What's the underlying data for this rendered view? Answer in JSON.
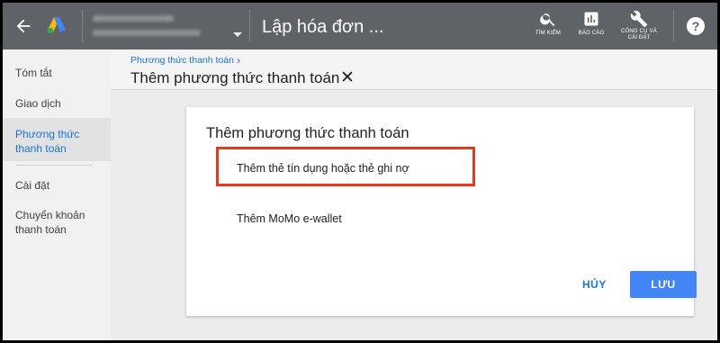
{
  "header": {
    "title": "Lập hóa đơn ...",
    "tools": [
      {
        "icon": "search-icon",
        "label": "TÌM KIẾM"
      },
      {
        "icon": "bar-chart-icon",
        "label": "BÁO CÁO"
      },
      {
        "icon": "wrench-icon",
        "label_line1": "CÔNG CỤ VÀ",
        "label_line2": "CÀI ĐẶT"
      }
    ],
    "help": "?"
  },
  "sidebar": {
    "items": [
      {
        "label": "Tóm tắt"
      },
      {
        "label": "Giao dịch"
      },
      {
        "label_line1": "Phương thức",
        "label_line2": "thanh toán",
        "active": true
      },
      {
        "label": "Cài đặt"
      },
      {
        "label_line1": "Chuyển khoản",
        "label_line2": "thanh toán"
      }
    ]
  },
  "main": {
    "breadcrumb": "Phương thức thanh toán",
    "sub_title": "Thêm phương thức thanh toán",
    "card": {
      "title": "Thêm phương thức thanh toán",
      "options": [
        {
          "label": "Thêm thẻ tín dụng hoặc thẻ ghi nợ",
          "highlighted": true
        },
        {
          "label": "Thêm MoMo e-wallet"
        }
      ],
      "cancel_label": "HỦY",
      "save_label": "LƯU"
    }
  },
  "colors": {
    "header_bg": "#5f6368",
    "accent": "#1a73e8",
    "primary_button": "#4285f4",
    "highlight_box": "#e53a1e"
  }
}
